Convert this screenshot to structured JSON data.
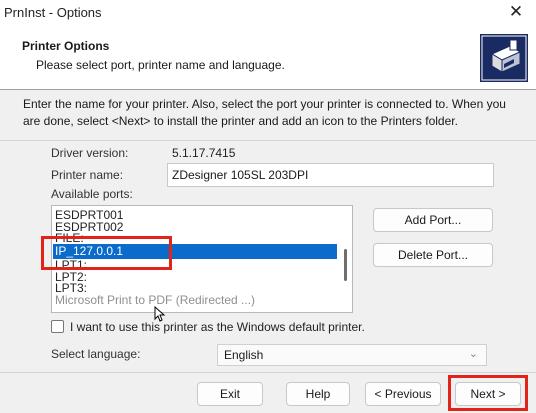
{
  "window": {
    "title": "PrnInst - Options",
    "close_glyph": "✕"
  },
  "header": {
    "title": "Printer Options",
    "subtitle": "Please select port, printer name and language."
  },
  "instructions": "Enter the name for your printer. Also, select the port your printer is connected to. When you are done, select <Next> to install the printer and add an icon to the Printers folder.",
  "driver": {
    "label": "Driver version:",
    "value": "5.1.17.7415"
  },
  "printer_name": {
    "label": "Printer name:",
    "value": "ZDesigner 105SL 203DPI"
  },
  "ports": {
    "label": "Available ports:",
    "items": [
      "ESDPRT001",
      "ESDPRT002",
      "FILE:",
      "IP_127.0.0.1",
      "LPT1:",
      "LPT2:",
      "LPT3:",
      "Microsoft Print to PDF (Redirected ...)"
    ],
    "selected": "IP_127.0.0.1"
  },
  "buttons": {
    "add_port": "Add Port...",
    "delete_port": "Delete Port...",
    "exit": "Exit",
    "help": "Help",
    "previous": "< Previous",
    "next": "Next >"
  },
  "default_printer": {
    "label": "I want to use this printer as the Windows default printer.",
    "checked": false
  },
  "language": {
    "label": "Select language:",
    "value": "English"
  },
  "colors": {
    "selection": "#0b6bcb",
    "highlight_box": "#e2231a"
  }
}
